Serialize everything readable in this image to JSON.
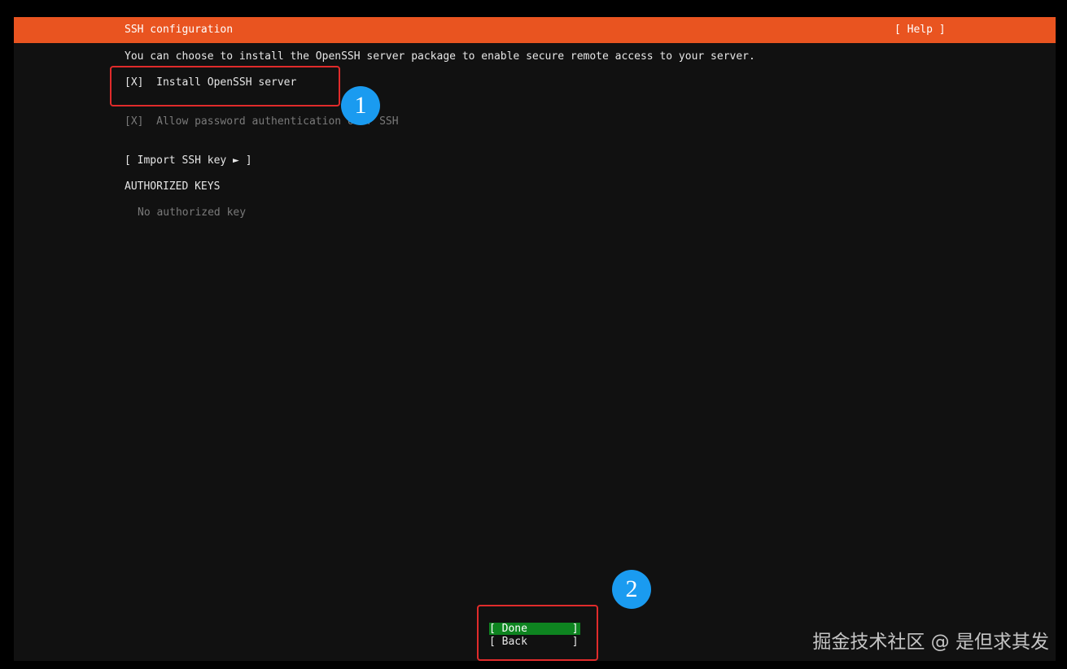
{
  "header": {
    "title": "SSH configuration",
    "help_label": "[ Help ]"
  },
  "main": {
    "intro_text": "You can choose to install the OpenSSH server package to enable secure remote access to your server.",
    "install_openssh": {
      "checkbox": "[X]",
      "label": "Install OpenSSH server",
      "checked": true
    },
    "allow_password": {
      "checkbox": "[X]",
      "label": "Allow password authentication over SSH",
      "checked": true,
      "enabled": false
    },
    "import_key_button": "[ Import SSH key ► ]",
    "authorized_keys_heading": "AUTHORIZED KEYS",
    "no_keys_text": "No authorized key"
  },
  "footer": {
    "done_button": "[ Done       ]",
    "back_button": "[ Back       ]"
  },
  "annotations": {
    "badge_1": "1",
    "badge_2": "2"
  },
  "watermark": "掘金技术社区 @ 是但求其发",
  "colors": {
    "header_bar": "#e95420",
    "screen_bg": "#111111",
    "done_highlight": "#0e8420",
    "annotation_box": "#e02b2b",
    "annotation_badge": "#1a9bf0"
  }
}
